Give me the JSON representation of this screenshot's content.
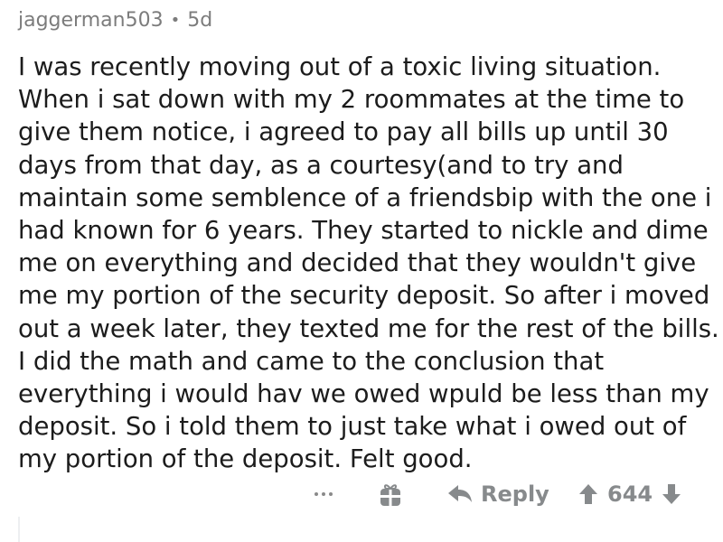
{
  "comment": {
    "username": "jaggerman503",
    "separator": "•",
    "age": "5d",
    "body_lines": [
      "I was recently moving out of a toxic living situation.",
      "When i sat down with my 2 roommates at the time to",
      "give them notice, i agreed to pay all bills up until 30",
      "days from that day, as a courtesy(and to try and",
      "maintain some semblence of a friendsbip with the one i",
      "had known for 6 years. They started to nickle and dime",
      "me on everything and decided that they wouldn't give",
      "me my portion of the security deposit.  So after i moved",
      "out a week later, they texted me for the rest of the bills.",
      "I did the math and came to the conclusion that",
      "everything i would hav we owed wpuld be less than my",
      "deposit. So i told them to just take what i owed out of",
      "my portion of the deposit. Felt good."
    ],
    "actions": {
      "more_icon": "more-dots-icon",
      "gift_icon": "gift-icon",
      "reply_icon": "reply-arrow-icon",
      "reply_label": "Reply",
      "upvote_icon": "upvote-arrow-icon",
      "score": "644",
      "downvote_icon": "downvote-arrow-icon"
    }
  },
  "colors": {
    "text": "#1c1c1c",
    "meta": "#7c7c7c",
    "action": "#878a8c"
  }
}
